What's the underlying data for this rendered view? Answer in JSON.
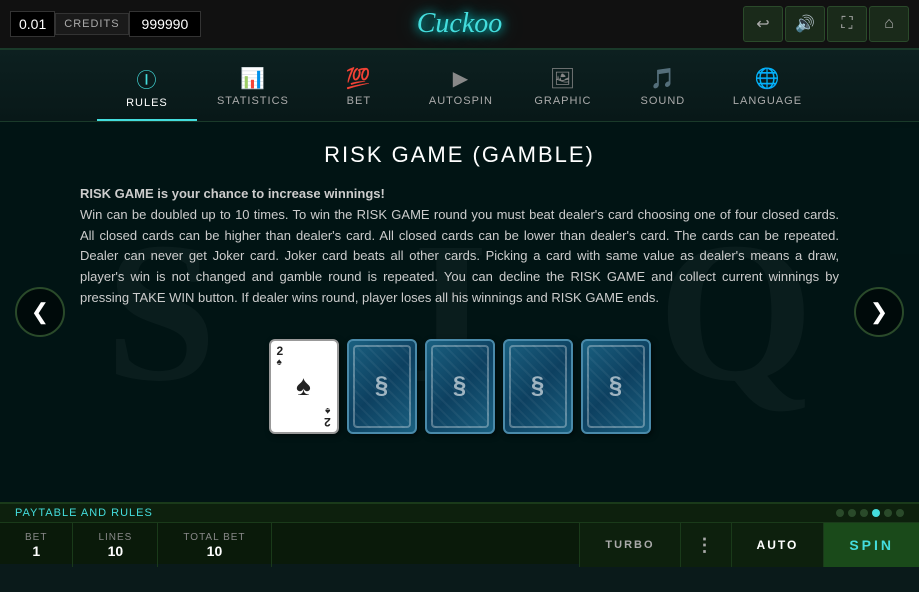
{
  "topBar": {
    "betValue": "0.01",
    "creditsLabel": "CREDITS",
    "creditsValue": "999990",
    "gameTitle": "Cuckoo"
  },
  "topControls": {
    "backIcon": "↩",
    "soundIcon": "🔊",
    "fullscreenIcon": "⛶",
    "menuIcon": "⌂"
  },
  "navTabs": [
    {
      "id": "rules",
      "label": "RULES",
      "icon": "ℹ",
      "active": true
    },
    {
      "id": "statistics",
      "label": "STATISTICS",
      "icon": "📊",
      "active": false
    },
    {
      "id": "bet",
      "label": "BET",
      "icon": "💯",
      "active": false
    },
    {
      "id": "autospin",
      "label": "AUTOSPIN",
      "icon": "▶",
      "active": false
    },
    {
      "id": "graphic",
      "label": "GRAPHIC",
      "icon": "🖼",
      "active": false
    },
    {
      "id": "sound",
      "label": "SOUND",
      "icon": "🎵",
      "active": false
    },
    {
      "id": "language",
      "label": "LANGUAGE",
      "icon": "🌐",
      "active": false
    }
  ],
  "mainContent": {
    "bgLetters": [
      "S",
      "J",
      "Q"
    ],
    "title": "RISK GAME (GAMBLE)",
    "paragraph": "RISK GAME is your chance to increase winnings!\nWin can be doubled up to 10 times. To win the RISK GAME round you must beat dealer's card choosing one of four closed cards. All closed cards can be higher than dealer's card. All closed cards can be lower than dealer's card. The cards can be repeated. Dealer can never get Joker card. Joker card beats all other cards. Picking a card with same value as dealer's means a draw, player's win is not changed and gamble round is repeated. You can decline the RISK GAME and collect current winnings by pressing TAKE WIN button. If dealer wins round, player loses all his winnings and RISK GAME ends."
  },
  "dealerCard": {
    "rank": "2",
    "suit": "♠",
    "suitColor": "#222"
  },
  "cardBackSymbol": "§",
  "paytable": {
    "label": "PAYTABLE AND RULES",
    "dots": [
      false,
      false,
      false,
      true,
      false,
      false
    ]
  },
  "bottomBar": {
    "bet": {
      "label": "BET",
      "value": "1"
    },
    "lines": {
      "label": "LINES",
      "value": "10"
    },
    "totalBet": {
      "label": "TOTAL BET",
      "value": "10"
    },
    "turboLabel": "TURBO",
    "autoLabel": "AUTO",
    "spinLabel": "SPIN"
  },
  "leftArrow": "❮",
  "rightArrow": "❯"
}
